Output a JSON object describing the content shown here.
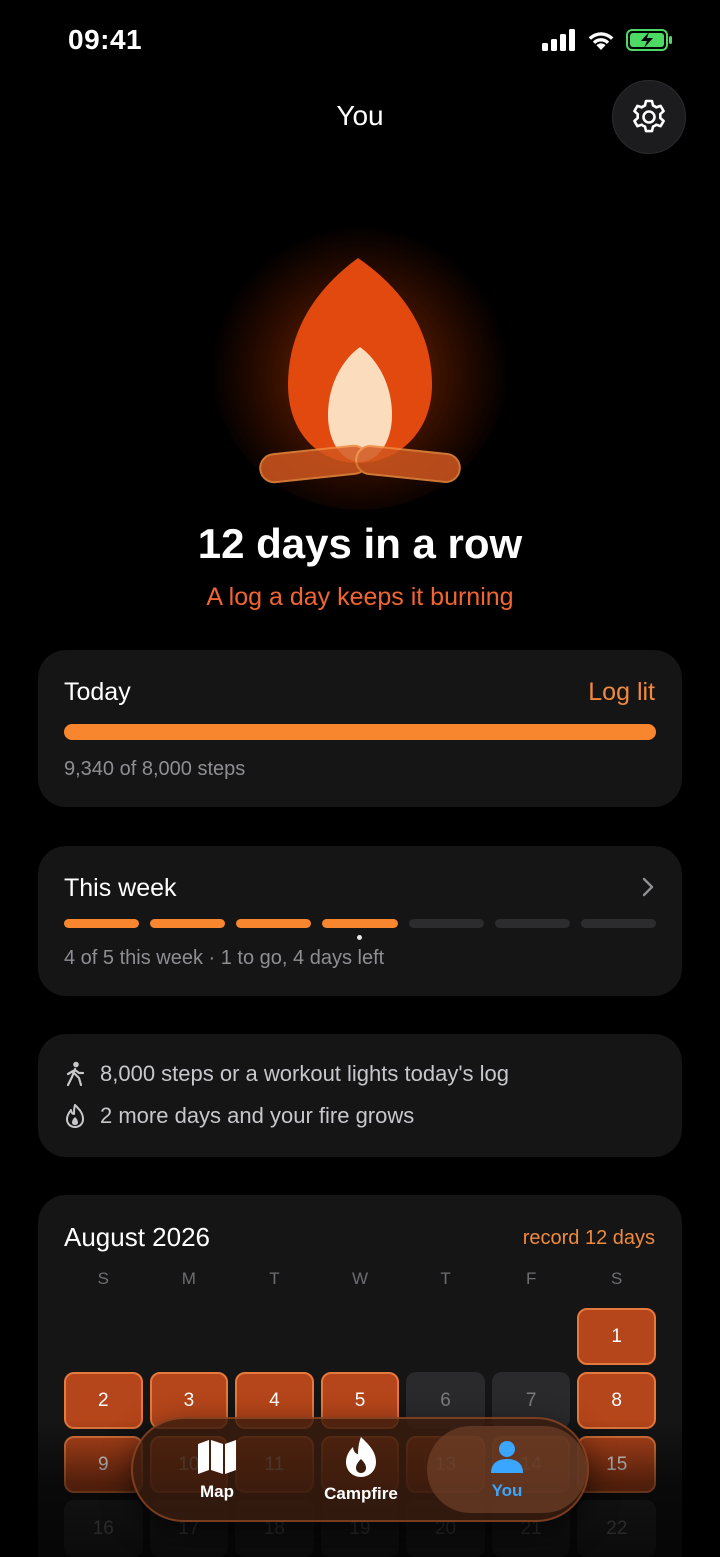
{
  "status_bar": {
    "time": "09:41"
  },
  "header": {
    "title": "You",
    "settings_icon": "gear-icon"
  },
  "hero": {
    "streak_title": "12 days in a row",
    "streak_subtitle": "A log a day keeps it burning",
    "accent_color": "#f26532"
  },
  "today": {
    "label": "Today",
    "status": "Log lit",
    "steps_text": "9,340 of 8,000 steps",
    "progress": 1.0
  },
  "week": {
    "label": "This week",
    "segments_total": 7,
    "segments_lit": 4,
    "summary": "4 of 5 this week · 1 to go, 4 days left"
  },
  "tips": [
    {
      "icon": "walking-person-icon",
      "text": "8,000 steps or a workout lights today's log"
    },
    {
      "icon": "flame-outline-icon",
      "text": "2 more days and your fire grows"
    }
  ],
  "calendar": {
    "month": "August 2026",
    "record": "record 12 days",
    "weekdays": [
      "S",
      "M",
      "T",
      "W",
      "T",
      "F",
      "S"
    ],
    "days": [
      {
        "d": "",
        "s": "empty"
      },
      {
        "d": "",
        "s": "empty"
      },
      {
        "d": "",
        "s": "empty"
      },
      {
        "d": "",
        "s": "empty"
      },
      {
        "d": "",
        "s": "empty"
      },
      {
        "d": "",
        "s": "empty"
      },
      {
        "d": "1",
        "s": "lit"
      },
      {
        "d": "2",
        "s": "lit"
      },
      {
        "d": "3",
        "s": "lit"
      },
      {
        "d": "4",
        "s": "lit"
      },
      {
        "d": "5",
        "s": "lit"
      },
      {
        "d": "6",
        "s": "dark"
      },
      {
        "d": "7",
        "s": "dark"
      },
      {
        "d": "8",
        "s": "lit"
      },
      {
        "d": "9",
        "s": "lit"
      },
      {
        "d": "10",
        "s": "lit"
      },
      {
        "d": "11",
        "s": "lit"
      },
      {
        "d": "12",
        "s": "lit"
      },
      {
        "d": "13",
        "s": "lit"
      },
      {
        "d": "14",
        "s": "lit"
      },
      {
        "d": "15",
        "s": "lit"
      },
      {
        "d": "16",
        "s": "dark"
      },
      {
        "d": "17",
        "s": "dark"
      },
      {
        "d": "18",
        "s": "dark"
      },
      {
        "d": "19",
        "s": "dark"
      },
      {
        "d": "20",
        "s": "dark"
      },
      {
        "d": "21",
        "s": "dark"
      },
      {
        "d": "22",
        "s": "dark"
      }
    ]
  },
  "tab_bar": {
    "tabs": [
      {
        "label": "Map",
        "icon": "map-icon"
      },
      {
        "label": "Campfire",
        "icon": "flame-icon"
      },
      {
        "label": "You",
        "icon": "person-icon",
        "active": true
      }
    ],
    "active_color": "#3aa6ff"
  }
}
